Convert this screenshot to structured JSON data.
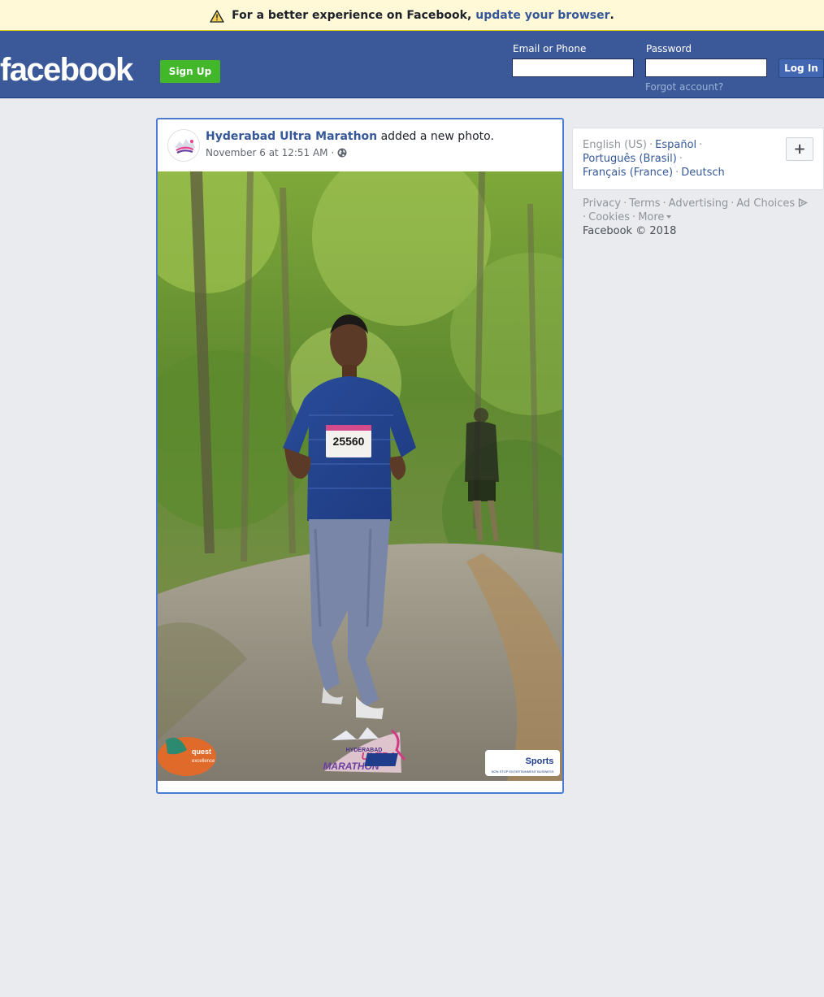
{
  "banner": {
    "message": "For a better experience on Facebook,",
    "link": "update your browser",
    "end": "."
  },
  "header": {
    "logo": "facebook",
    "signup_label": "Sign Up",
    "email_label": "Email or Phone",
    "password_label": "Password",
    "login_label": "Log In",
    "forgot_label": "Forgot account?"
  },
  "post": {
    "author": "Hyderabad Ultra Marathon",
    "action": " added a new photo.",
    "timestamp": "November 6 at 12:51 AM",
    "meta_sep": "·",
    "photo": {
      "bib_number": "25560",
      "event_logo_line1": "HYDERABAD",
      "event_logo_line2": "ULTRA",
      "event_logo_line3": "MARATHON",
      "sponsor_left_line1": "quest",
      "sponsor_left_line2": "excellence",
      "sponsor_right_brand": "NEB",
      "sponsor_right_word": "Sports",
      "sponsor_right_tagline": "NON STOP ENTERTAINMENT BUSINESS"
    }
  },
  "languages": {
    "current": "English (US)",
    "items": [
      "Español",
      "Português (Brasil)",
      "Français (France)",
      "Deutsch"
    ],
    "plus": "+"
  },
  "footer": {
    "links": [
      "Privacy",
      "Terms",
      "Advertising",
      "Ad Choices",
      "Cookies",
      "More"
    ],
    "copyright": "Facebook © 2018"
  },
  "colors": {
    "brand_blue": "#3b5998",
    "link_blue": "#365899",
    "signup_green": "#42b72a",
    "banner_yellow": "#fff9d7",
    "page_bg": "#e9ebee"
  }
}
